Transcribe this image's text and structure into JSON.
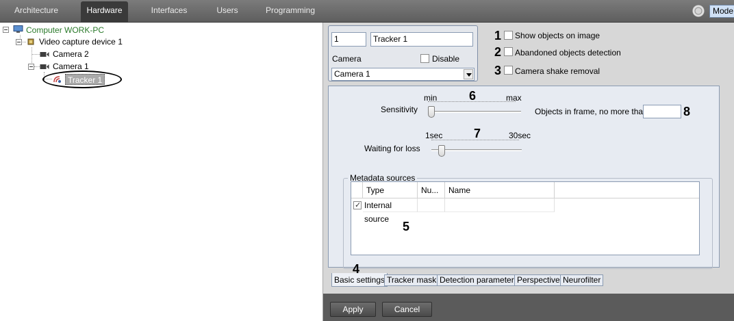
{
  "topbar": {
    "tabs": [
      {
        "label": "Architecture"
      },
      {
        "label": "Hardware"
      },
      {
        "label": "Interfaces"
      },
      {
        "label": "Users"
      },
      {
        "label": "Programming"
      }
    ],
    "active_tab": "Hardware",
    "mode_label": "Mode:"
  },
  "tree": {
    "computer": "Computer WORK-PC",
    "device": "Video capture device 1",
    "camera2": "Camera 2",
    "camera1": "Camera 1",
    "tracker": "Tracker 1"
  },
  "object": {
    "id": "1",
    "name": "Tracker 1",
    "camera_label": "Camera",
    "disable_label": "Disable",
    "camera_value": "Camera 1"
  },
  "options": [
    {
      "num": "1",
      "label": "Show objects on image",
      "checked": false
    },
    {
      "num": "2",
      "label": "Abandoned objects detection",
      "checked": false
    },
    {
      "num": "3",
      "label": "Camera shake removal",
      "checked": false
    }
  ],
  "sensitivity": {
    "num": "6",
    "label": "Sensitivity",
    "min_label": "min",
    "max_label": "max",
    "value_fraction": 0.0
  },
  "waiting": {
    "num": "7",
    "label": "Waiting for loss",
    "min_label": "1sec",
    "max_label": "30sec",
    "value_fraction": 0.08
  },
  "objects_in_frame": {
    "num": "8",
    "label": "Objects in frame, no more than",
    "value": ""
  },
  "metadata": {
    "title": "Metadata sources",
    "num": "5",
    "columns": [
      "Type",
      "Nu...",
      "Name"
    ],
    "rows": [
      {
        "type": "Internal source",
        "number": "",
        "name": "",
        "checked": true
      }
    ]
  },
  "bottom_tabs": {
    "num": "4",
    "items": [
      "Basic settings",
      "Tracker mask",
      "Detection parameters",
      "Perspective",
      "Neurofilter"
    ],
    "active": "Basic settings"
  },
  "footer": {
    "apply": "Apply",
    "cancel": "Cancel"
  }
}
